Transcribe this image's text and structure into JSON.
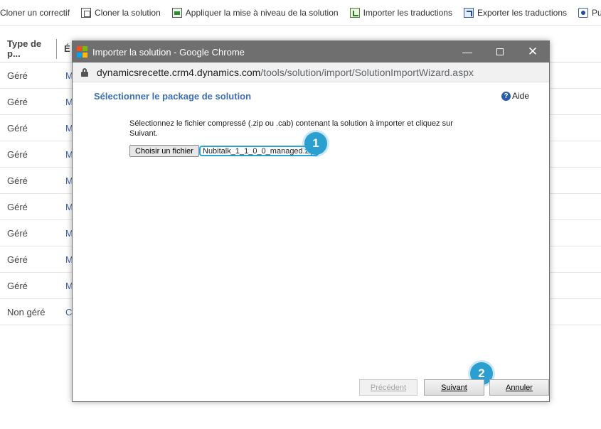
{
  "toolbar": {
    "items": [
      {
        "label": "Cloner un correctif",
        "icon": "none"
      },
      {
        "label": "Cloner la solution",
        "icon": "clone-icon"
      },
      {
        "label": "Appliquer la mise à niveau de la solution",
        "icon": "upgrade-icon"
      },
      {
        "label": "Importer les traductions",
        "icon": "import-icon"
      },
      {
        "label": "Exporter les traductions",
        "icon": "export-icon"
      },
      {
        "label": "Publier t",
        "icon": "publish-icon"
      }
    ]
  },
  "grid": {
    "col1_header": "Type de p...",
    "col2_header": "É",
    "rows": [
      {
        "type": "Géré",
        "name": "M"
      },
      {
        "type": "Géré",
        "name": "M"
      },
      {
        "type": "Géré",
        "name": "M"
      },
      {
        "type": "Géré",
        "name": "M"
      },
      {
        "type": "Géré",
        "name": "M"
      },
      {
        "type": "Géré",
        "name": "M"
      },
      {
        "type": "Géré",
        "name": "M"
      },
      {
        "type": "Géré",
        "name": "M"
      },
      {
        "type": "Géré",
        "name": "M"
      },
      {
        "type": "Non géré",
        "name": "C"
      }
    ]
  },
  "dialog": {
    "window_title": "Importer la solution - Google Chrome",
    "url_host": "dynamicsrecette.crm4.dynamics.com",
    "url_path": "/tools/solution/import/SolutionImportWizard.aspx",
    "heading": "Sélectionner le package de solution",
    "help_label": "Aide",
    "instructions": "Sélectionnez le fichier compressé (.zip ou .cab) contenant la solution à importer et cliquez sur Suivant.",
    "choose_file_label": "Choisir un fichier",
    "file_name": "Nubitalk_1_1_0_0_managed.zip",
    "badge1": "1",
    "badge2": "2",
    "prev_label": "Précédent",
    "next_label": "Suivant",
    "cancel_label": "Annuler"
  },
  "colors": {
    "heading": "#3b6fb6",
    "badge": "#2a9fd0",
    "titlebar": "#6f6f6f",
    "link": "#3b5fa8"
  }
}
